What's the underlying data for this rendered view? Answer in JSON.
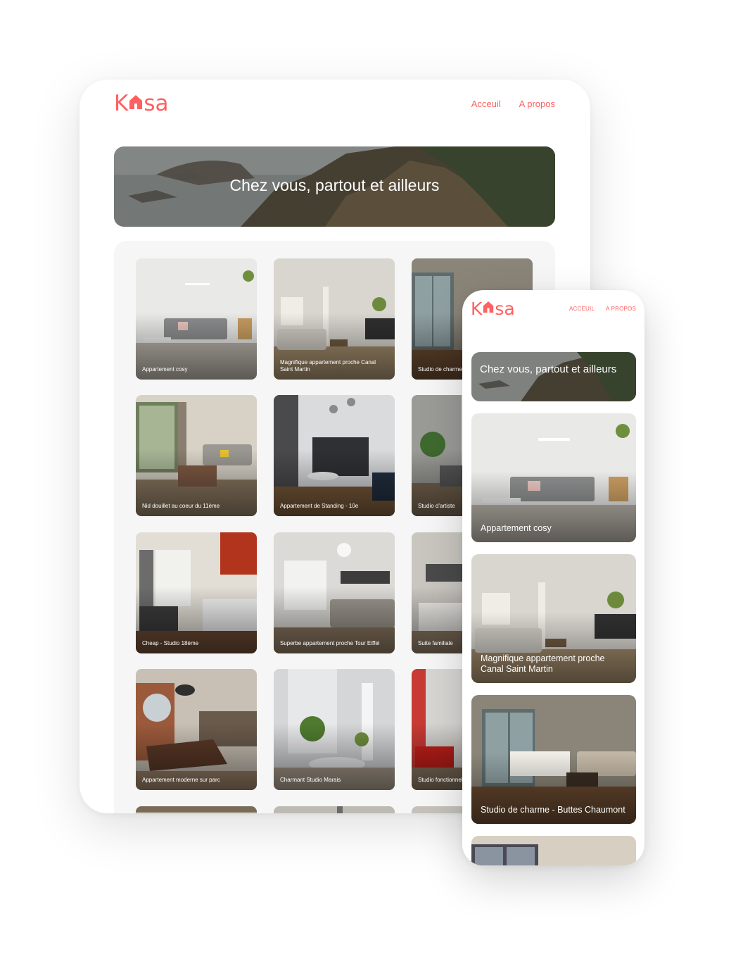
{
  "brand": {
    "logo_left": "K",
    "logo_right": "sa",
    "color": "#ff6060"
  },
  "tablet": {
    "nav": {
      "home": "Acceuil",
      "about": "A propos"
    },
    "banner_title": "Chez vous, partout et ailleurs",
    "cards": [
      "Appartement cosy",
      "Magnifique appartement proche Canal Saint Martin",
      "Studio de charme - Buttes Chaumont",
      "Nid douillet au coeur du 11ème",
      "Appartement de Standing - 10e",
      "Studio d'artiste",
      "Cheap - Studio 18ème",
      "Superbe appartement proche Tour Eiffel",
      "Suite familiale",
      "Appartement moderne sur parc",
      "Charmant Studio Marais",
      "Studio fonctionnel",
      "",
      "",
      ""
    ]
  },
  "phone": {
    "nav": {
      "home": "ACCEUIL",
      "about": "A PROPOS"
    },
    "banner_title": "Chez vous, partout et ailleurs",
    "cards": [
      "Appartement cosy",
      "Magnifique appartement proche Canal Saint Martin",
      "Studio de charme - Buttes Chaumont",
      ""
    ]
  }
}
